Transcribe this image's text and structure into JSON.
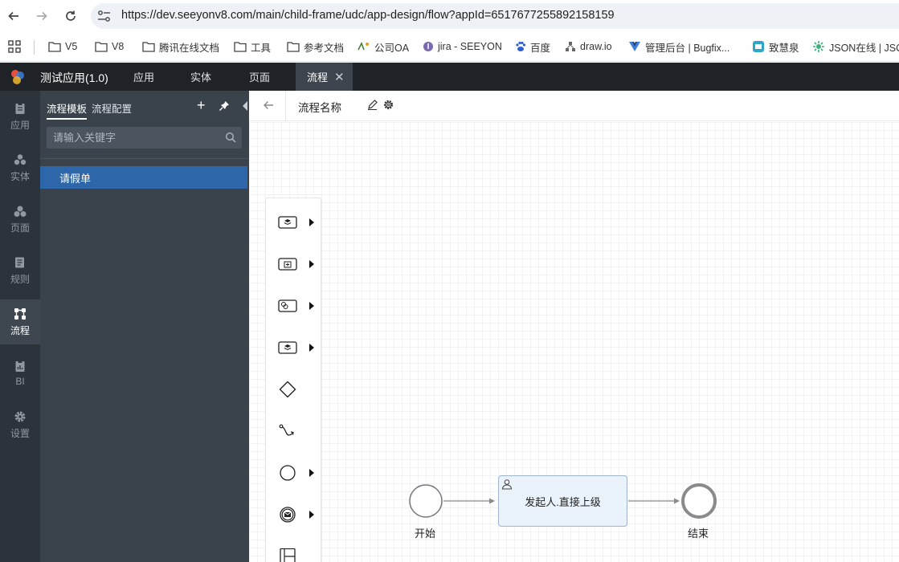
{
  "browser": {
    "url": "https://dev.seeyonv8.com/main/child-frame/udc/app-design/flow?appId=6517677255892158159",
    "bookmarks": [
      {
        "label": "V5",
        "icon": "folder-icon"
      },
      {
        "label": "V8",
        "icon": "folder-icon"
      },
      {
        "label": "腾讯在线文档",
        "icon": "folder-icon"
      },
      {
        "label": "工具",
        "icon": "folder-icon"
      },
      {
        "label": "参考文档",
        "icon": "folder-icon"
      },
      {
        "label": "公司OA",
        "icon": "oa-icon"
      },
      {
        "label": "jira - SEEYON",
        "icon": "jira-icon"
      },
      {
        "label": "百度",
        "icon": "baidu-icon"
      },
      {
        "label": "draw.io",
        "icon": "drawio-icon"
      },
      {
        "label": "管理后台 | Bugfix...",
        "icon": "vue-icon"
      },
      {
        "label": "致慧泉",
        "icon": "app-icon"
      },
      {
        "label": "JSON在线 | JSON",
        "icon": "json-icon"
      }
    ]
  },
  "header": {
    "app_title": "测试应用(1.0)",
    "tabs": [
      {
        "label": "应用"
      },
      {
        "label": "实体"
      },
      {
        "label": "页面"
      },
      {
        "label": "流程",
        "active": true,
        "closable": true
      }
    ],
    "close_glyph": "✕"
  },
  "rail": {
    "items": [
      {
        "label": "应用",
        "icon": "clipboard-icon"
      },
      {
        "label": "实体",
        "icon": "entity-icon"
      },
      {
        "label": "页面",
        "icon": "page-icon"
      },
      {
        "label": "规则",
        "icon": "rule-icon"
      },
      {
        "label": "流程",
        "icon": "flow-icon",
        "active": true
      },
      {
        "label": "BI",
        "icon": "bi-icon"
      },
      {
        "label": "设置",
        "icon": "gear-icon"
      }
    ]
  },
  "panel": {
    "tabs": [
      {
        "label": "流程模板",
        "active": true
      },
      {
        "label": "流程配置"
      }
    ],
    "add_glyph": "+",
    "search_placeholder": "请输入关键字",
    "templates": [
      {
        "label": "请假单",
        "selected": true
      }
    ]
  },
  "designer": {
    "flow_name": "流程名称",
    "palette": [
      {
        "icon": "task-stack-icon",
        "has_submenu": true
      },
      {
        "icon": "subprocess-icon",
        "has_submenu": true
      },
      {
        "icon": "service-task-icon",
        "has_submenu": true
      },
      {
        "icon": "task-stack-icon",
        "has_submenu": true
      },
      {
        "icon": "gateway-icon",
        "has_submenu": false
      },
      {
        "icon": "connector-icon",
        "has_submenu": false
      },
      {
        "icon": "start-event-icon",
        "has_submenu": true
      },
      {
        "icon": "message-event-icon",
        "has_submenu": true
      },
      {
        "icon": "lane-icon",
        "has_submenu": false
      }
    ],
    "nodes": {
      "start": {
        "label": "开始"
      },
      "task": {
        "label": "发起人.直接上级"
      },
      "end": {
        "label": "结束"
      }
    }
  },
  "colors": {
    "header_bg": "#1f2328",
    "rail_bg": "#2c333a",
    "panel_bg": "#3a434c",
    "selected_item": "#2d67a9",
    "task_fill": "#eaf3fc"
  }
}
